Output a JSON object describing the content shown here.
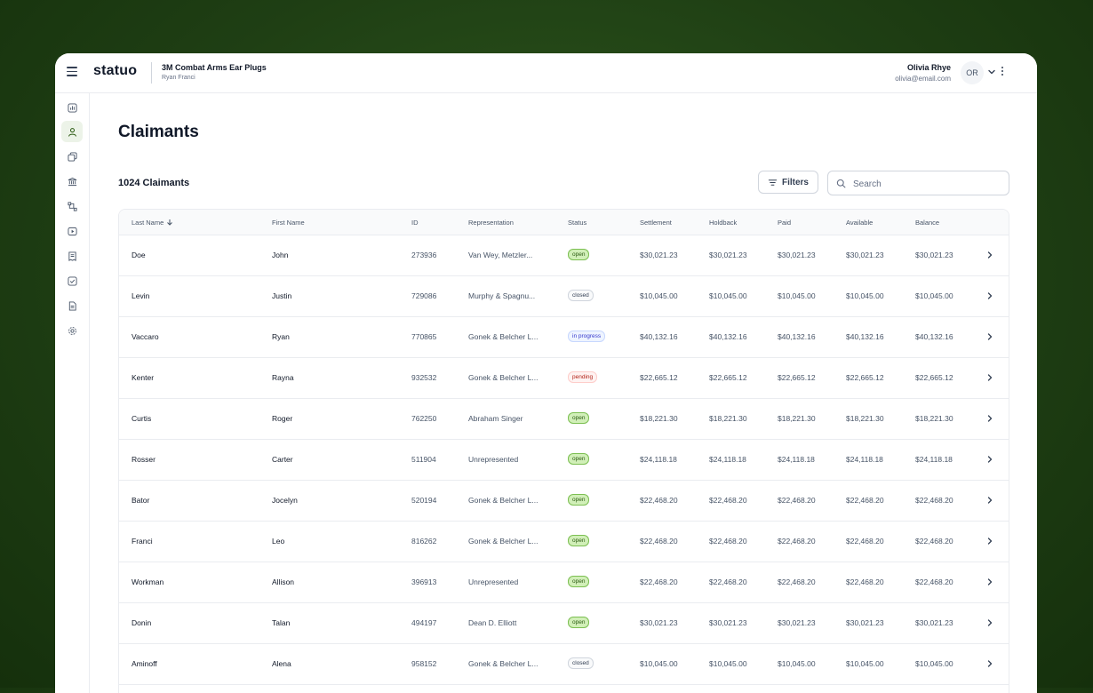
{
  "app": {
    "logo": "statuo",
    "case_title": "3M Combat Arms Ear Plugs",
    "case_subtitle": "Ryan Franci"
  },
  "user": {
    "name": "Olivia Rhye",
    "email": "olivia@email.com",
    "initials": "OR"
  },
  "sidebar": {
    "items": [
      {
        "icon": "chart-icon",
        "active": false
      },
      {
        "icon": "user-icon",
        "active": true
      },
      {
        "icon": "copy-icon",
        "active": false
      },
      {
        "icon": "bank-icon",
        "active": false
      },
      {
        "icon": "dataflow-icon",
        "active": false
      },
      {
        "icon": "play-icon",
        "active": false
      },
      {
        "icon": "receipt-icon",
        "active": false
      },
      {
        "icon": "check-square-icon",
        "active": false
      },
      {
        "icon": "file-icon",
        "active": false
      },
      {
        "icon": "settings-icon",
        "active": false
      }
    ]
  },
  "page": {
    "title": "Claimants",
    "count_label": "1024 Claimants",
    "filters_label": "Filters",
    "search_placeholder": "Search"
  },
  "table": {
    "columns": [
      "Last Name",
      "First Name",
      "ID",
      "Representation",
      "Status",
      "Settlement",
      "Holdback",
      "Paid",
      "Available",
      "Balance"
    ],
    "sort_column": "Last Name",
    "sort_direction": "descending",
    "rows": [
      {
        "last": "Doe",
        "first": "John",
        "id": "273936",
        "rep": "Van Wey, Metzler...",
        "status": "open",
        "settlement": "$30,021.23",
        "holdback": "$30,021.23",
        "paid": "$30,021.23",
        "available": "$30,021.23",
        "balance": "$30,021.23"
      },
      {
        "last": "Levin",
        "first": "Justin",
        "id": "729086",
        "rep": "Murphy & Spagnu...",
        "status": "closed",
        "settlement": "$10,045.00",
        "holdback": "$10,045.00",
        "paid": "$10,045.00",
        "available": "$10,045.00",
        "balance": "$10,045.00"
      },
      {
        "last": "Vaccaro",
        "first": "Ryan",
        "id": "770865",
        "rep": "Gonek & Belcher L...",
        "status": "in progress",
        "settlement": "$40,132.16",
        "holdback": "$40,132.16",
        "paid": "$40,132.16",
        "available": "$40,132.16",
        "balance": "$40,132.16"
      },
      {
        "last": "Kenter",
        "first": "Rayna",
        "id": "932532",
        "rep": "Gonek & Belcher L...",
        "status": "pending",
        "settlement": "$22,665.12",
        "holdback": "$22,665.12",
        "paid": "$22,665.12",
        "available": "$22,665.12",
        "balance": "$22,665.12"
      },
      {
        "last": "Curtis",
        "first": "Roger",
        "id": "762250",
        "rep": "Abraham Singer",
        "status": "open",
        "settlement": "$18,221.30",
        "holdback": "$18,221.30",
        "paid": "$18,221.30",
        "available": "$18,221.30",
        "balance": "$18,221.30"
      },
      {
        "last": "Rosser",
        "first": "Carter",
        "id": "511904",
        "rep": "Unrepresented",
        "status": "open",
        "settlement": "$24,118.18",
        "holdback": "$24,118.18",
        "paid": "$24,118.18",
        "available": "$24,118.18",
        "balance": "$24,118.18"
      },
      {
        "last": "Bator",
        "first": "Jocelyn",
        "id": "520194",
        "rep": "Gonek & Belcher L...",
        "status": "open",
        "settlement": "$22,468.20",
        "holdback": "$22,468.20",
        "paid": "$22,468.20",
        "available": "$22,468.20",
        "balance": "$22,468.20"
      },
      {
        "last": "Franci",
        "first": "Leo",
        "id": "816262",
        "rep": "Gonek & Belcher L...",
        "status": "open",
        "settlement": "$22,468.20",
        "holdback": "$22,468.20",
        "paid": "$22,468.20",
        "available": "$22,468.20",
        "balance": "$22,468.20"
      },
      {
        "last": "Workman",
        "first": "Allison",
        "id": "396913",
        "rep": "Unrepresented",
        "status": "open",
        "settlement": "$22,468.20",
        "holdback": "$22,468.20",
        "paid": "$22,468.20",
        "available": "$22,468.20",
        "balance": "$22,468.20"
      },
      {
        "last": "Donin",
        "first": "Talan",
        "id": "494197",
        "rep": "Dean D. Elliott",
        "status": "open",
        "settlement": "$30,021.23",
        "holdback": "$30,021.23",
        "paid": "$30,021.23",
        "available": "$30,021.23",
        "balance": "$30,021.23"
      },
      {
        "last": "Aminoff",
        "first": "Alena",
        "id": "958152",
        "rep": "Gonek & Belcher L...",
        "status": "closed",
        "settlement": "$10,045.00",
        "holdback": "$10,045.00",
        "paid": "$10,045.00",
        "available": "$10,045.00",
        "balance": "$10,045.00"
      }
    ]
  },
  "colors": {
    "background": "#1f3f14",
    "accent": "#2b5a12",
    "status_open": "#d1efb8",
    "status_in_progress": "#eef4ff",
    "status_pending": "#fef3f2"
  }
}
